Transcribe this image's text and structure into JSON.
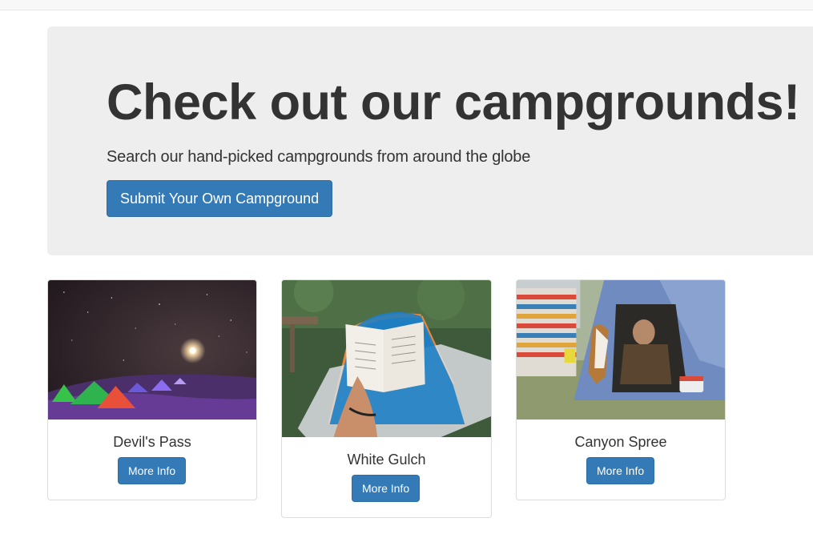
{
  "jumbotron": {
    "title": "Check out our campgrounds!",
    "subtitle": "Search our hand-picked campgrounds from around the globe",
    "submit_button": "Submit Your Own Campground"
  },
  "campgrounds": [
    {
      "name": "Devil's Pass",
      "button": "More Info",
      "image": "night-tents-photo"
    },
    {
      "name": "White Gulch",
      "button": "More Info",
      "image": "book-in-tent-photo"
    },
    {
      "name": "Canyon Spree",
      "button": "More Info",
      "image": "dog-at-tent-photo"
    }
  ],
  "colors": {
    "primary": "#337ab7",
    "jumbotron_bg": "#eeeeee",
    "text": "#333333"
  }
}
